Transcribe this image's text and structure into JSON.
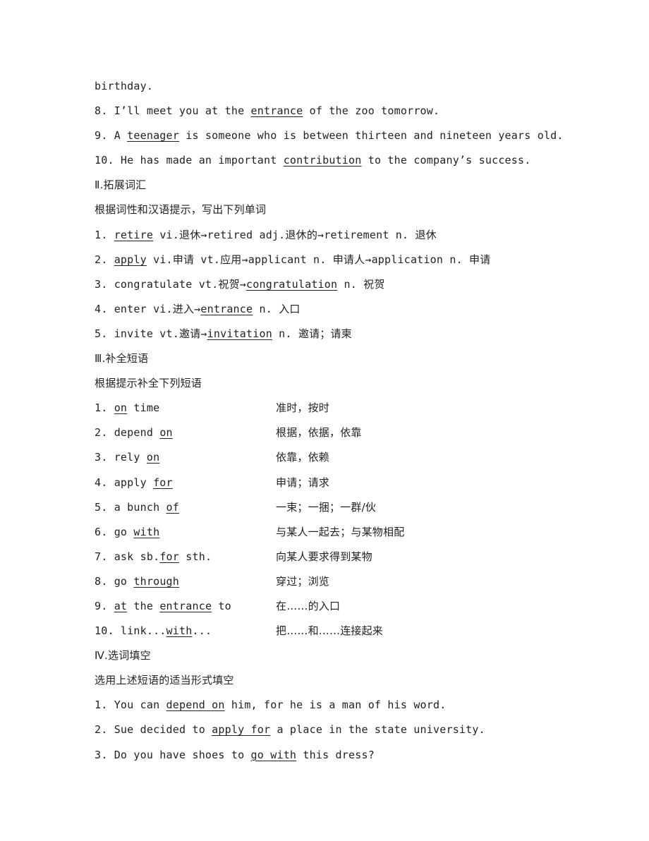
{
  "section1_tail": {
    "continuation": [
      {
        "t": "birthday."
      }
    ],
    "items": [
      [
        {
          "t": "8. I’ll meet you at the "
        },
        {
          "t": "entrance",
          "u": true
        },
        {
          "t": " of the zoo tomorrow."
        }
      ],
      [
        {
          "t": "9. A "
        },
        {
          "t": "teenager",
          "u": true
        },
        {
          "t": " is someone who is between thirteen and nineteen years old."
        }
      ],
      [
        {
          "t": "10. He has made an important "
        },
        {
          "t": "contribution",
          "u": true
        },
        {
          "t": " to the company’s success."
        }
      ]
    ]
  },
  "section2": {
    "heading": "Ⅱ.拓展词汇",
    "instruction": "根据词性和汉语提示，写出下列单词",
    "items": [
      [
        {
          "t": "1. "
        },
        {
          "t": "retire",
          "u": true
        },
        {
          "t": " vi.退休→retired adj.退休的→retirement n. 退休"
        }
      ],
      [
        {
          "t": "2. "
        },
        {
          "t": "apply",
          "u": true
        },
        {
          "t": " vi.申请 vt.应用→applicant n. 申请人→application n. 申请"
        }
      ],
      [
        {
          "t": "3. congratulate vt.祝贺→"
        },
        {
          "t": "congratulation",
          "u": true
        },
        {
          "t": " n. 祝贺"
        }
      ],
      [
        {
          "t": "4. enter vi.进入→"
        },
        {
          "t": "entrance",
          "u": true
        },
        {
          "t": " n. 入口"
        }
      ],
      [
        {
          "t": "5. invite vt.邀请→"
        },
        {
          "t": "invitation",
          "u": true
        },
        {
          "t": " n. 邀请；请柬"
        }
      ]
    ]
  },
  "section3": {
    "heading": "Ⅲ.补全短语",
    "instruction": "根据提示补全下列短语",
    "items": [
      {
        "en": [
          {
            "t": "1. "
          },
          {
            "t": "on",
            "u": true
          },
          {
            "t": " time"
          }
        ],
        "zh": "准时，按时"
      },
      {
        "en": [
          {
            "t": "2. depend "
          },
          {
            "t": "on",
            "u": true
          }
        ],
        "zh": "根据，依据，依靠"
      },
      {
        "en": [
          {
            "t": "3. rely "
          },
          {
            "t": "on",
            "u": true
          }
        ],
        "zh": "依靠，依赖"
      },
      {
        "en": [
          {
            "t": "4. apply "
          },
          {
            "t": "for",
            "u": true
          }
        ],
        "zh": "申请；请求"
      },
      {
        "en": [
          {
            "t": "5. a bunch "
          },
          {
            "t": "of",
            "u": true
          }
        ],
        "zh": "一束；一捆；一群/伙"
      },
      {
        "en": [
          {
            "t": "6. go "
          },
          {
            "t": "with",
            "u": true
          }
        ],
        "zh": "与某人一起去；与某物相配"
      },
      {
        "en": [
          {
            "t": "7. ask sb."
          },
          {
            "t": "for",
            "u": true
          },
          {
            "t": " sth."
          }
        ],
        "zh": "向某人要求得到某物"
      },
      {
        "en": [
          {
            "t": "8. go "
          },
          {
            "t": "through",
            "u": true
          }
        ],
        "zh": "穿过；浏览"
      },
      {
        "en": [
          {
            "t": "9. "
          },
          {
            "t": "at",
            "u": true
          },
          {
            "t": " the "
          },
          {
            "t": "entrance",
            "u": true
          },
          {
            "t": " to"
          }
        ],
        "zh": "在……的入口"
      },
      {
        "en": [
          {
            "t": "10. link..."
          },
          {
            "t": "with",
            "u": true
          },
          {
            "t": "..."
          }
        ],
        "zh": "把……和……连接起来"
      }
    ]
  },
  "section4": {
    "heading": "Ⅳ.选词填空",
    "instruction": "选用上述短语的适当形式填空",
    "items": [
      [
        {
          "t": "1. You can "
        },
        {
          "t": "depend on",
          "u": true
        },
        {
          "t": " him, for he is a man of his word."
        }
      ],
      [
        {
          "t": "2. Sue decided to "
        },
        {
          "t": "apply for",
          "u": true
        },
        {
          "t": " a place in the state university."
        }
      ],
      [
        {
          "t": "3. Do you have shoes to "
        },
        {
          "t": "go with",
          "u": true
        },
        {
          "t": " this dress?"
        }
      ]
    ]
  }
}
